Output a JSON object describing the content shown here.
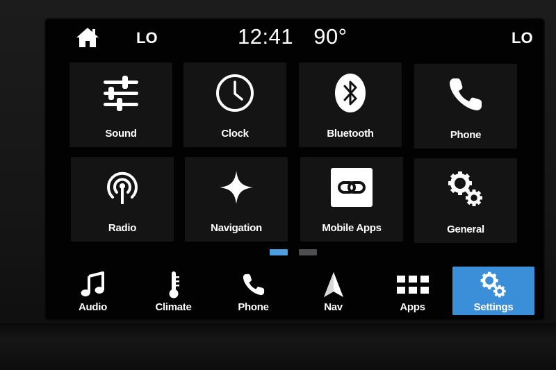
{
  "status_bar": {
    "left_climate": "LO",
    "time": "12:41",
    "temperature": "90°",
    "right_climate": "LO"
  },
  "settings_grid": [
    {
      "label": "Sound",
      "icon": "sliders-icon"
    },
    {
      "label": "Clock",
      "icon": "clock-icon"
    },
    {
      "label": "Bluetooth",
      "icon": "bluetooth-icon"
    },
    {
      "label": "Phone",
      "icon": "phone-icon"
    },
    {
      "label": "Radio",
      "icon": "radio-antenna-icon"
    },
    {
      "label": "Navigation",
      "icon": "star-sparkle-icon"
    },
    {
      "label": "Mobile Apps",
      "icon": "link-icon"
    },
    {
      "label": "General",
      "icon": "gears-icon"
    }
  ],
  "page_indicator": {
    "pages": 2,
    "current": 1
  },
  "nav_bar": [
    {
      "label": "Audio",
      "icon": "music-note-icon"
    },
    {
      "label": "Climate",
      "icon": "thermometer-icon"
    },
    {
      "label": "Phone",
      "icon": "phone-icon"
    },
    {
      "label": "Nav",
      "icon": "navigation-arrow-icon"
    },
    {
      "label": "Apps",
      "icon": "apps-grid-icon"
    },
    {
      "label": "Settings",
      "icon": "gears-icon",
      "selected": true
    }
  ],
  "colors": {
    "accent": "#3a8fd8",
    "page_dot_active": "#4f9fe0",
    "tile_background": "#141414",
    "screen_background": "#020202"
  }
}
